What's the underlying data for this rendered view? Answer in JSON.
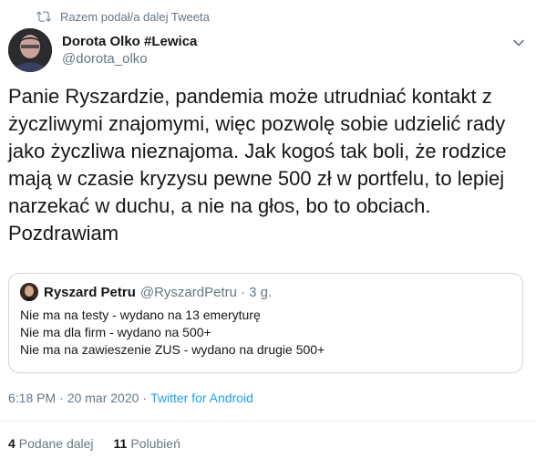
{
  "retweet": {
    "label": "Razem podał/a dalej Tweeta"
  },
  "author": {
    "display_name": "Dorota Olko #Lewica",
    "handle": "@dorota_olko"
  },
  "tweet": {
    "text": "Panie Ryszardzie, pandemia może utrudniać kontakt z\nżyczliwymi znajomymi, więc pozwolę sobie udzielić rady\njako życzliwa nieznajoma. Jak kogoś tak boli, że rodzice\nmają w czasie kryzysu pewne 500 zł w portfelu, to lepiej\nnarzekać w duchu, a nie na głos, bo to obciach.\nPozdrawiam"
  },
  "quoted_tweet": {
    "display_name": "Ryszard Petru",
    "handle": "@RyszardPetru",
    "time": "· 3 g.",
    "lines": [
      "Nie ma na testy - wydano na 13 emeryturę",
      "Nie ma dla firm - wydano na 500+",
      "Nie ma na zawieszenie ZUS - wydano na drugie 500+"
    ]
  },
  "meta": {
    "time": "6:18 PM",
    "dot": "·",
    "date": "20 mar 2020",
    "source": "Twitter for Android"
  },
  "stats": {
    "retweets_count": "4",
    "retweets_label": "Podane dalej",
    "likes_count": "11",
    "likes_label": "Polubień"
  },
  "colors": {
    "link": "#1da1f2",
    "secondary": "#657786",
    "border": "#ccd6dd"
  },
  "icons": [
    "retweet-icon",
    "chevron-down-icon"
  ]
}
